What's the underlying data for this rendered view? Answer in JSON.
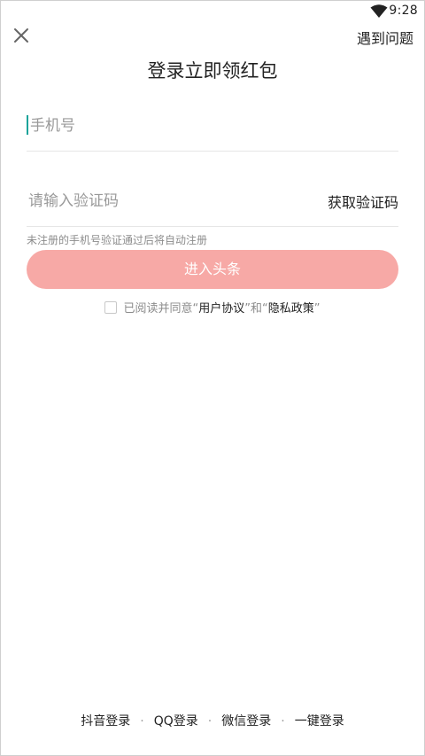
{
  "status_bar": {
    "time": "9:28",
    "wifi_icon": "wifi-icon"
  },
  "header": {
    "close_icon": "close-icon",
    "help_label": "遇到问题",
    "title": "登录立即领红包"
  },
  "form": {
    "phone_placeholder": "手机号",
    "code_placeholder": "请输入验证码",
    "get_code_label": "获取验证码",
    "hint": "未注册的手机号验证通过后将自动注册",
    "submit_label": "进入头条",
    "submit_color": "#f7a9a6"
  },
  "agreement": {
    "prefix": "已阅读并同意",
    "q1_open": "“",
    "user_agreement": "用户协议",
    "q1_close": "”",
    "and": "和",
    "q2_open": "“",
    "privacy_policy": "隐私政策",
    "q2_close": "”",
    "checked": false
  },
  "alt_logins": [
    "抖音登录",
    "QQ登录",
    "微信登录",
    "一键登录"
  ],
  "separator": "·"
}
